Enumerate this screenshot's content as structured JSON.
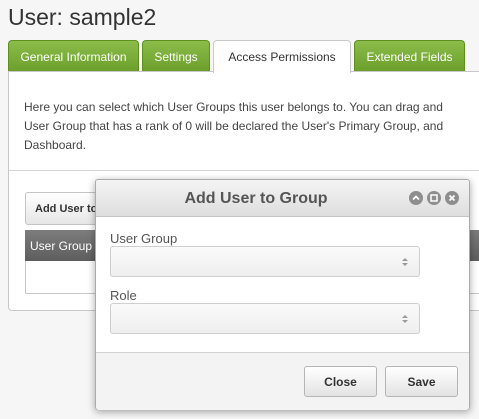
{
  "page": {
    "title": "User: sample2"
  },
  "tabs": [
    {
      "label": "General Information",
      "active": false
    },
    {
      "label": "Settings",
      "active": false
    },
    {
      "label": "Access Permissions",
      "active": true
    },
    {
      "label": "Extended Fields",
      "active": false
    }
  ],
  "panel": {
    "intro_lines": [
      "Here you can select which User Groups this user belongs to. You can drag and",
      "User Group that has a rank of 0 will be declared the User's Primary Group, and",
      "Dashboard."
    ],
    "add_button_label": "Add User to",
    "table_header": "User Group"
  },
  "dialog": {
    "title": "Add User to Group",
    "icons": [
      "collapse-icon",
      "maximize-icon",
      "close-icon"
    ],
    "fields": [
      {
        "label": "User Group",
        "value": ""
      },
      {
        "label": "Role",
        "value": ""
      }
    ],
    "close_label": "Close",
    "save_label": "Save"
  },
  "colors": {
    "tab_green": "#7aaa35",
    "table_header": "#6b6b6b",
    "dialog_footer": "#f3f3f3"
  }
}
